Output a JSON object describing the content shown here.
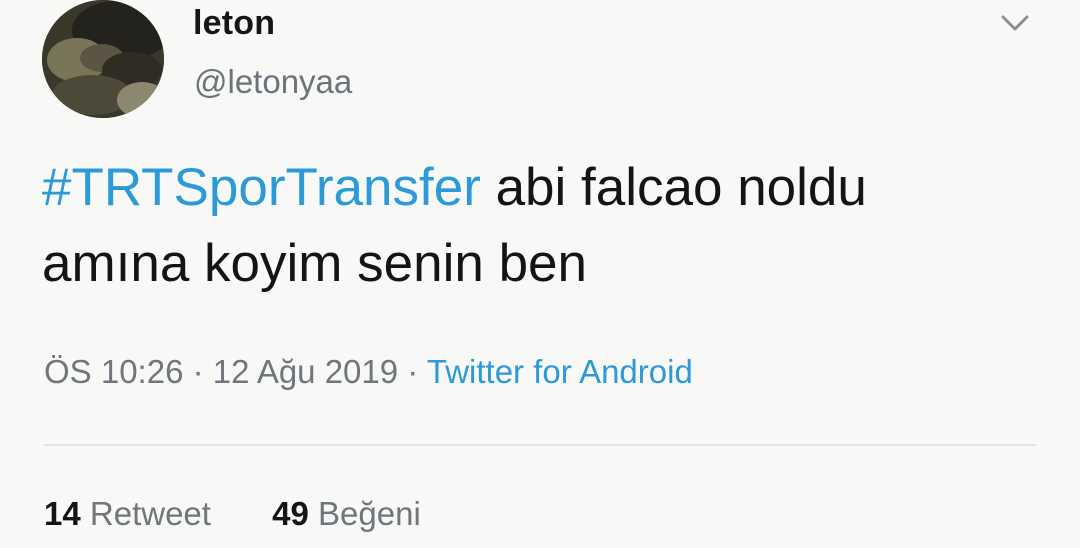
{
  "tweet": {
    "user": {
      "name": "leton",
      "handle": "@letonyaa"
    },
    "menu_icon": "chevron-down-icon",
    "text": {
      "hashtag": "#TRTSporTransfer",
      "line1_rest": " abi falcao noldu",
      "line2": "amına koyim senin ben"
    },
    "meta": {
      "time": "ÖS 10:26",
      "separator": " · ",
      "date": "12 Ağu 2019",
      "separator2": " · ",
      "source": "Twitter for Android"
    },
    "stats": {
      "retweets_count": "14",
      "retweets_label": "Retweet",
      "likes_count": "49",
      "likes_label": "Beğeni"
    },
    "colors": {
      "link": "#2b9ad7",
      "muted": "#6f767c"
    }
  }
}
